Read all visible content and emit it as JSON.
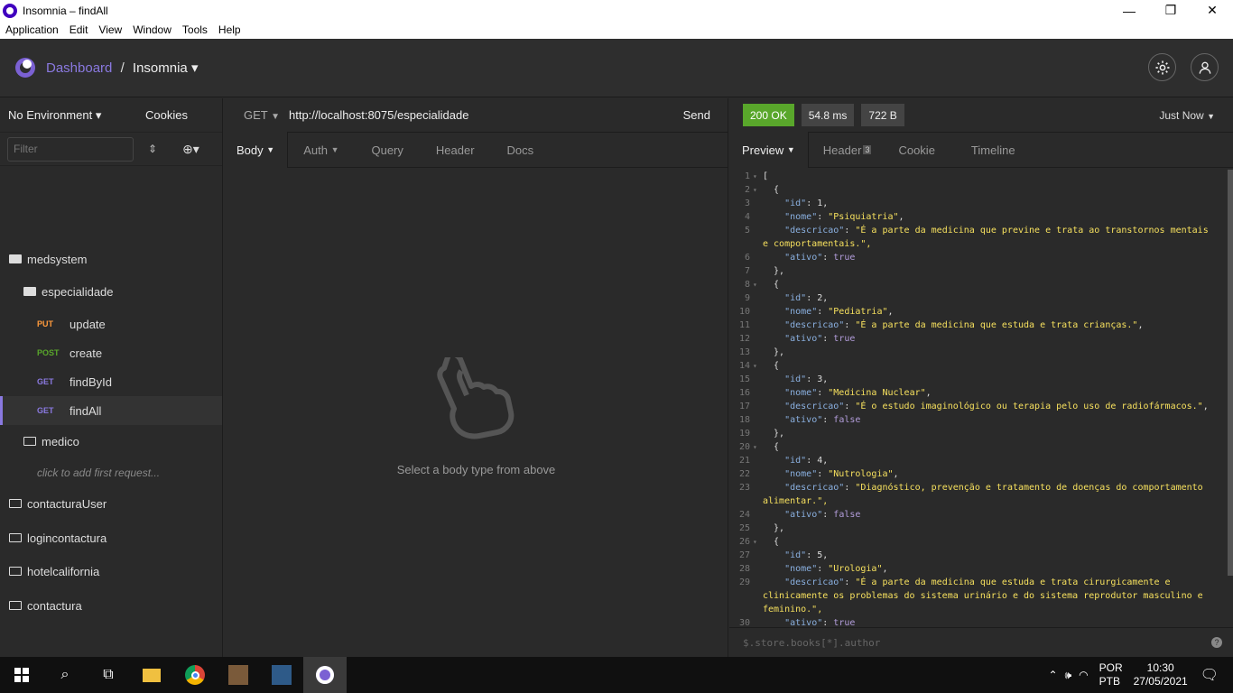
{
  "window": {
    "title": "Insomnia – findAll",
    "minimize": "—",
    "maximize": "❐",
    "close": "✕"
  },
  "menu": [
    "Application",
    "Edit",
    "View",
    "Window",
    "Tools",
    "Help"
  ],
  "header": {
    "dashboard": "Dashboard",
    "separator": "/",
    "workspace": "Insomnia",
    "caret": "▾"
  },
  "sidebar": {
    "environment": "No Environment ▾",
    "cookies": "Cookies",
    "filter_placeholder": "Filter",
    "items": [
      {
        "label": "medsystem"
      },
      {
        "label": "especialidade"
      },
      {
        "method": "PUT",
        "label": "update"
      },
      {
        "method": "POST",
        "label": "create"
      },
      {
        "method": "GET",
        "label": "findById"
      },
      {
        "method": "GET",
        "label": "findAll"
      },
      {
        "label": "medico"
      },
      {
        "label": "click to add first request..."
      },
      {
        "label": "contacturaUser"
      },
      {
        "label": "logincontactura"
      },
      {
        "label": "hotelcalifornia"
      },
      {
        "label": "contactura"
      }
    ]
  },
  "request": {
    "method": "GET",
    "url": "http://localhost:8075/especialidade",
    "send": "Send",
    "tabs": [
      "Body",
      "Auth",
      "Query",
      "Header",
      "Docs"
    ],
    "empty_message": "Select a body type from above"
  },
  "response": {
    "status": "200 OK",
    "time": "54.8 ms",
    "size": "722 B",
    "when": "Just Now",
    "tabs": [
      "Preview",
      "Header",
      "Cookie",
      "Timeline"
    ],
    "header_count": "3",
    "filter_placeholder": "$.store.books[*].author",
    "help": "?"
  },
  "code_lines": [
    {
      "n": "1",
      "f": "▾",
      "t": "["
    },
    {
      "n": "2",
      "f": "▾",
      "t": "  {"
    },
    {
      "n": "3",
      "f": "",
      "t": "    \"id\": 1,"
    },
    {
      "n": "4",
      "f": "",
      "t": "    \"nome\": \"Psiquiatria\","
    },
    {
      "n": "5",
      "f": "",
      "t": "    \"descricao\": \"É a parte da medicina que previne e trata ao transtornos mentais"
    },
    {
      "n": "",
      "f": "",
      "t": "e comportamentais.\","
    },
    {
      "n": "6",
      "f": "",
      "t": "    \"ativo\": true"
    },
    {
      "n": "7",
      "f": "",
      "t": "  },"
    },
    {
      "n": "8",
      "f": "▾",
      "t": "  {"
    },
    {
      "n": "9",
      "f": "",
      "t": "    \"id\": 2,"
    },
    {
      "n": "10",
      "f": "",
      "t": "    \"nome\": \"Pediatria\","
    },
    {
      "n": "11",
      "f": "",
      "t": "    \"descricao\": \"É a parte da medicina que estuda e trata crianças.\","
    },
    {
      "n": "12",
      "f": "",
      "t": "    \"ativo\": true"
    },
    {
      "n": "13",
      "f": "",
      "t": "  },"
    },
    {
      "n": "14",
      "f": "▾",
      "t": "  {"
    },
    {
      "n": "15",
      "f": "",
      "t": "    \"id\": 3,"
    },
    {
      "n": "16",
      "f": "",
      "t": "    \"nome\": \"Medicina Nuclear\","
    },
    {
      "n": "17",
      "f": "",
      "t": "    \"descricao\": \"É o estudo imaginológico ou terapia pelo uso de radiofármacos.\","
    },
    {
      "n": "18",
      "f": "",
      "t": "    \"ativo\": false"
    },
    {
      "n": "19",
      "f": "",
      "t": "  },"
    },
    {
      "n": "20",
      "f": "▾",
      "t": "  {"
    },
    {
      "n": "21",
      "f": "",
      "t": "    \"id\": 4,"
    },
    {
      "n": "22",
      "f": "",
      "t": "    \"nome\": \"Nutrologia\","
    },
    {
      "n": "23",
      "f": "",
      "t": "    \"descricao\": \"Diagnóstico, prevenção e tratamento de doenças do comportamento"
    },
    {
      "n": "",
      "f": "",
      "t": "alimentar.\","
    },
    {
      "n": "24",
      "f": "",
      "t": "    \"ativo\": false"
    },
    {
      "n": "25",
      "f": "",
      "t": "  },"
    },
    {
      "n": "26",
      "f": "▾",
      "t": "  {"
    },
    {
      "n": "27",
      "f": "",
      "t": "    \"id\": 5,"
    },
    {
      "n": "28",
      "f": "",
      "t": "    \"nome\": \"Urologia\","
    },
    {
      "n": "29",
      "f": "",
      "t": "    \"descricao\": \"É a parte da medicina que estuda e trata cirurgicamente e"
    },
    {
      "n": "",
      "f": "",
      "t": "clinicamente os problemas do sistema urinário e do sistema reprodutor masculino e"
    },
    {
      "n": "",
      "f": "",
      "t": "feminino.\","
    },
    {
      "n": "30",
      "f": "",
      "t": "    \"ativo\": true"
    }
  ],
  "taskbar": {
    "lang1": "POR",
    "lang2": "PTB",
    "time": "10:30",
    "date": "27/05/2021"
  },
  "colors": {
    "accent": "#8a79e0",
    "ok": "#59a72b",
    "put": "#ff9a3c",
    "post": "#59a72b"
  }
}
